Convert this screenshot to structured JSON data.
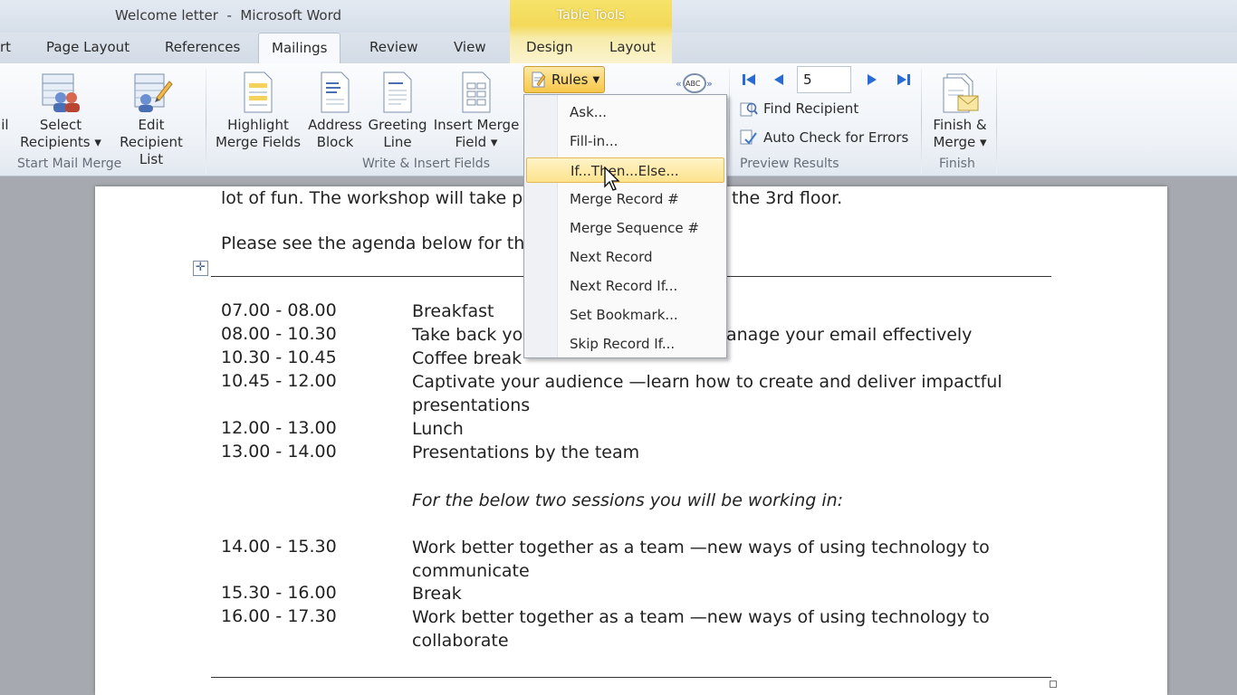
{
  "window": {
    "title": "Welcome letter  -  Microsoft Word",
    "context_tab_group": "Table Tools"
  },
  "tabs": [
    {
      "label": "rt"
    },
    {
      "label": "Page Layout"
    },
    {
      "label": "References"
    },
    {
      "label": "Mailings",
      "active": true
    },
    {
      "label": "Review"
    },
    {
      "label": "View"
    },
    {
      "label": "Design"
    },
    {
      "label": "Layout"
    }
  ],
  "ribbon": {
    "start_mail_merge": {
      "label": "Start Mail Merge",
      "partial_button": {
        "line1": "ail",
        "line2": "▾"
      },
      "select_recipients": {
        "line1": "Select",
        "line2": "Recipients ▾"
      },
      "edit_recipient_list": {
        "line1": "Edit",
        "line2": "Recipient List"
      }
    },
    "write_insert_fields": {
      "label": "Write & Insert Fields",
      "highlight": {
        "line1": "Highlight",
        "line2": "Merge Fields"
      },
      "address_block": {
        "line1": "Address",
        "line2": "Block"
      },
      "greeting_line": {
        "line1": "Greeting",
        "line2": "Line"
      },
      "insert_merge_field": {
        "line1": "Insert Merge",
        "line2": "Field ▾"
      },
      "rules_label": "Rules"
    },
    "preview_results": {
      "label": "Preview Results",
      "record_number": "5",
      "find_recipient": "Find Recipient",
      "auto_check": "Auto Check for Errors"
    },
    "finish": {
      "label": "Finish",
      "finish_merge": {
        "line1": "Finish &",
        "line2": "Merge ▾"
      }
    }
  },
  "rules_menu": {
    "items": [
      {
        "label": "Ask..."
      },
      {
        "label": "Fill-in..."
      },
      {
        "label": "If...Then...Else...",
        "highlighted": true
      },
      {
        "label": "Merge Record #"
      },
      {
        "label": "Merge Sequence #"
      },
      {
        "label": "Next Record"
      },
      {
        "label": "Next Record If..."
      },
      {
        "label": "Set Bookmark..."
      },
      {
        "label": "Skip Record If..."
      }
    ]
  },
  "document": {
    "para1_left": "lot of fun. The workshop will take p",
    "para1_right": "the 3rd floor.",
    "para2": "Please see the agenda below for th",
    "agenda": [
      {
        "time": "07.00 - 08.00",
        "desc": "Breakfast"
      },
      {
        "time": "08.00 - 10.30",
        "desc_left": "Take back yo",
        "desc_right": "anage your email effectively"
      },
      {
        "time": "10.30 - 10.45",
        "desc": "Coffee break"
      },
      {
        "time": "10.45 - 12.00",
        "desc": "Captivate your audience —learn how to create and deliver impactful",
        "desc2": "presentations"
      },
      {
        "time": "12.00 - 13.00",
        "desc": "Lunch"
      },
      {
        "time": "13.00 - 14.00",
        "desc": "Presentations by the team"
      },
      {
        "note": "For the below two sessions you will be working in:"
      },
      {
        "time": "14.00 - 15.30",
        "desc": "Work better together as a team —new ways of using technology to",
        "desc2": "communicate"
      },
      {
        "time": "15.30 - 16.00",
        "desc": "Break"
      },
      {
        "time": "16.00 - 17.30",
        "desc": "Work better together as a team —new ways of using technology to",
        "desc2": "collaborate"
      }
    ]
  },
  "colors": {
    "accent_gold": "#f8c74a",
    "nav_blue": "#2a6ad3"
  }
}
